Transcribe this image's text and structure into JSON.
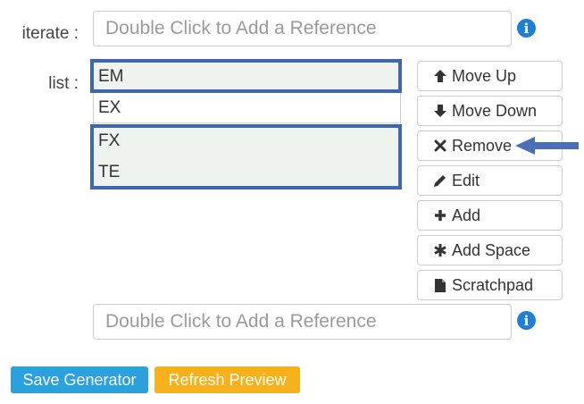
{
  "iterate": {
    "label": "iterate :",
    "placeholder": "Double Click to Add a Reference",
    "info_icon": "info-icon"
  },
  "list": {
    "label": "list :",
    "items": [
      "EM",
      "EX",
      "FX",
      "TE"
    ],
    "selected": [
      "EM",
      "FX",
      "TE"
    ]
  },
  "buttons": {
    "move_up": "Move Up",
    "move_down": "Move Down",
    "remove": "Remove",
    "edit": "Edit",
    "add": "Add",
    "add_space": "Add Space",
    "scratchpad": "Scratchpad"
  },
  "bottom_reference": {
    "placeholder": "Double Click to Add a Reference"
  },
  "actions": {
    "save": "Save Generator",
    "refresh": "Refresh Preview"
  },
  "colors": {
    "highlight_border": "#3f66b0",
    "save_button": "#2aa0dc",
    "refresh_button": "#f7b21b",
    "info_icon": "#1f7fd6",
    "pointer_arrow": "#4a6fb8"
  }
}
